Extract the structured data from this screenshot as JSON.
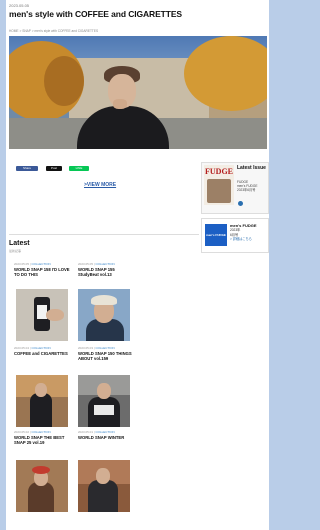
{
  "header": {
    "date": "2023.05.05",
    "title": "men's style with COFFEE and CIGARETTES",
    "breadcrumb": "HOME > SNAP > men's style with COFFEE and CIGARETTES"
  },
  "share": {
    "facebook": "Share",
    "twitter": "Post",
    "line": "LINE"
  },
  "view_more": ">VIEW MORE",
  "sidebar": {
    "latest_issue_heading": "Latest Issue",
    "latest_issue_lines": [
      "FUDGE",
      "men's FUDGE",
      "2023年6月号"
    ],
    "fudge_logo": "FUDGE",
    "mens_logo": "men's FUDGE",
    "mens_lines": [
      "men's FUDGE",
      "2023年",
      "6月号",
      "> 詳細はこちら"
    ]
  },
  "latest": {
    "heading": "Latest",
    "sub": "最新記事"
  },
  "cards": [
    {
      "date": "2023.05.05",
      "cat": "COLLECTION",
      "title": "WORLD SNAP 158 I'D LOVE TO DO THIS"
    },
    {
      "date": "2023.05.05",
      "cat": "COLLECTION",
      "title": "WORLD SNAP 155 StudyBeat vol.13"
    },
    {
      "date": "2023.05.04",
      "cat": "COLLECTION",
      "title": "COFFEE and CIGARETTES"
    },
    {
      "date": "2023.05.03",
      "cat": "COLLECTION",
      "title": "WORLD SNAP 150 THINGS ABOUT vol.159"
    },
    {
      "date": "2023.05.02",
      "cat": "COLLECTION",
      "title": "WORLD SNAP THE BEST SNAP 25 vol.19"
    },
    {
      "date": "2023.05.01",
      "cat": "COLLECTION",
      "title": "WORLD SNAP WINTER"
    }
  ]
}
